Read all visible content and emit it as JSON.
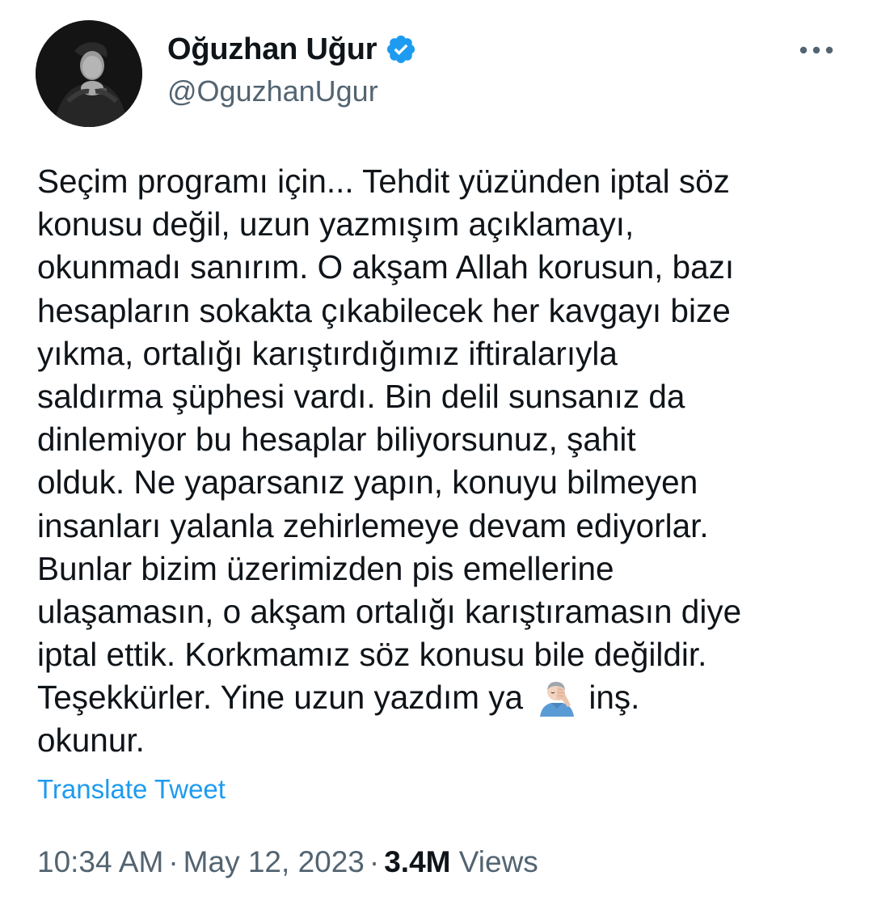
{
  "author": {
    "display_name": "Oğuzhan Uğur",
    "handle": "@OguzhanUgur",
    "verified_icon": "verified-badge-icon",
    "verified_color": "#1d9bf0"
  },
  "tweet": {
    "lines": [
      "Seçim programı için... Tehdit yüzünden iptal söz",
      "konusu değil, uzun yazmışım açıklamayı,",
      "okunmadı sanırım. O akşam Allah korusun, bazı",
      "hesapların sokakta çıkabilecek her kavgayı bize",
      "yıkma, ortalığı karıştırdığımız iftiralarıyla",
      "saldırma şüphesi vardı. Bin delil sunsanız da",
      "dinlemiyor bu hesaplar biliyorsunuz, şahit",
      "olduk. Ne yaparsanız yapın, konuyu bilmeyen",
      "insanları yalanla zehirlemeye devam ediyorlar.",
      "Bunlar bizim üzerimizden pis emellerine",
      "ulaşamasın, o akşam ortalığı karıştıramasın diye",
      "iptal ettik. Korkmamız söz konusu bile değildir."
    ],
    "line13_before_emoji": "Teşekkürler. Yine uzun yazdım ya",
    "emoji": "man-facepalming-emoji",
    "line13_after_emoji": "inş.",
    "line14": "okunur."
  },
  "translate_label": "Translate Tweet",
  "meta": {
    "time": "10:34 AM",
    "separator": "·",
    "date": "May 12, 2023",
    "views_count": "3.4M",
    "views_label": "Views"
  },
  "more_icon": "more-dots-icon"
}
